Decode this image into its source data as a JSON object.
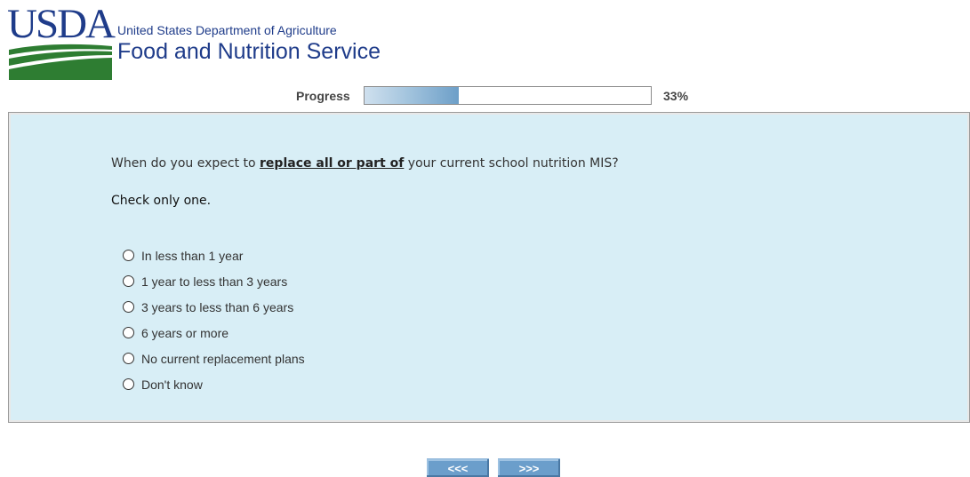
{
  "header": {
    "logo_text": "USDA",
    "department": "United States Department of Agriculture",
    "agency": "Food and Nutrition Service"
  },
  "progress": {
    "label": "Progress",
    "value": 0.33,
    "percent_text": "33%"
  },
  "question": {
    "text_before": "When do you expect to ",
    "text_emphasis": "replace all or part of",
    "text_after": " your current school nutrition MIS?",
    "instruction": "Check only one.",
    "options": [
      "In less than 1 year",
      "1 year to less than 3 years",
      "3 years to less than 6 years",
      "6 years or more",
      "No current replacement plans",
      "Don't know"
    ]
  },
  "navigation": {
    "prev_label": "<<<",
    "next_label": ">>>"
  },
  "colors": {
    "brand_blue": "#1f3c8a",
    "brand_green": "#2e7d32",
    "panel_background": "#d8eef6",
    "button_blue": "#6b9ecb"
  }
}
